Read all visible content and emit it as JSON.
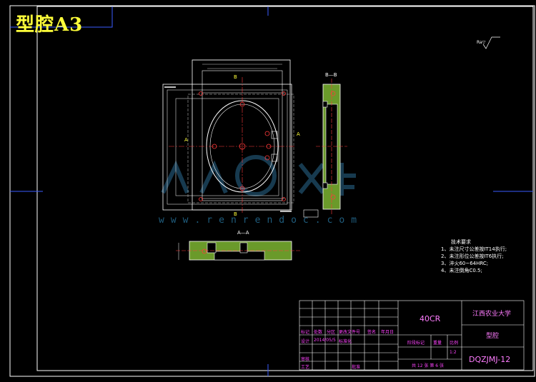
{
  "sheet": {
    "tag": "型腔A3",
    "watermark": "www.renrendoc.com",
    "watermark_logo": "人人文库",
    "roughness_note": "Ra▽"
  },
  "views": {
    "section_bb": "B—B",
    "section_aa": "A—A",
    "cut_a": "A",
    "cut_b": "B"
  },
  "notes": {
    "heading": "技术要求",
    "items": [
      "1、未注尺寸公差按IT14执行;",
      "2、未注形位公差按IT6执行;",
      "3、淬火60~64HRC;",
      "4、未注倒角C0.5;"
    ]
  },
  "title_block": {
    "material": "40CR",
    "school": "江西农业大学",
    "part_name": "型腔",
    "drawing_no": "DQZJMJ-12",
    "row_labels": [
      "标记",
      "处数",
      "分区",
      "更改文件号",
      "签名",
      "年月日"
    ],
    "row_labels2": [
      "设计",
      "标准化",
      "审核",
      "工艺",
      "批准"
    ],
    "date_hint": "2014/05/5",
    "stage_label": "阶段标记",
    "weight_label": "重量",
    "scale_label": "比例",
    "scale": "1:2",
    "sheet_info": "共 12 张 第 6 张"
  }
}
